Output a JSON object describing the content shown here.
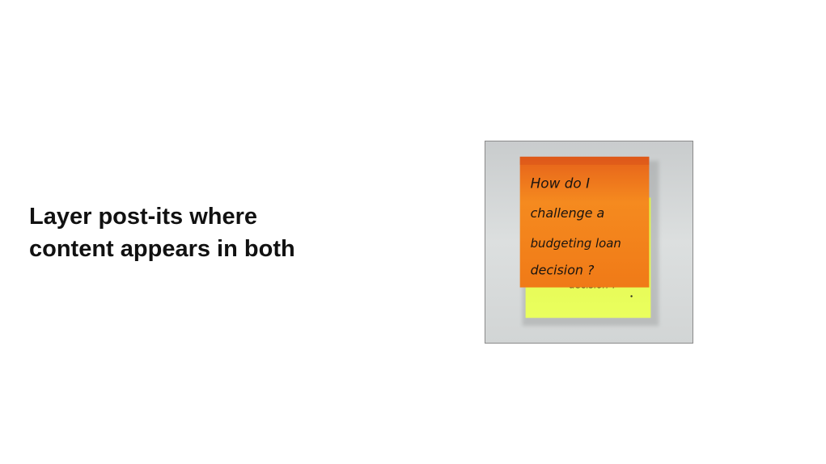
{
  "slide": {
    "caption_line1": "Layer post-its where",
    "caption_line2": "content appears in both"
  },
  "photo": {
    "icon": "layered-post-its-photo",
    "front_note": {
      "color": "#f07f1c",
      "lines": [
        "How do I",
        "challenge a",
        "budgeting loan",
        "decision ?"
      ]
    },
    "back_note": {
      "color": "#e8ff57",
      "text": "decision ?"
    }
  }
}
